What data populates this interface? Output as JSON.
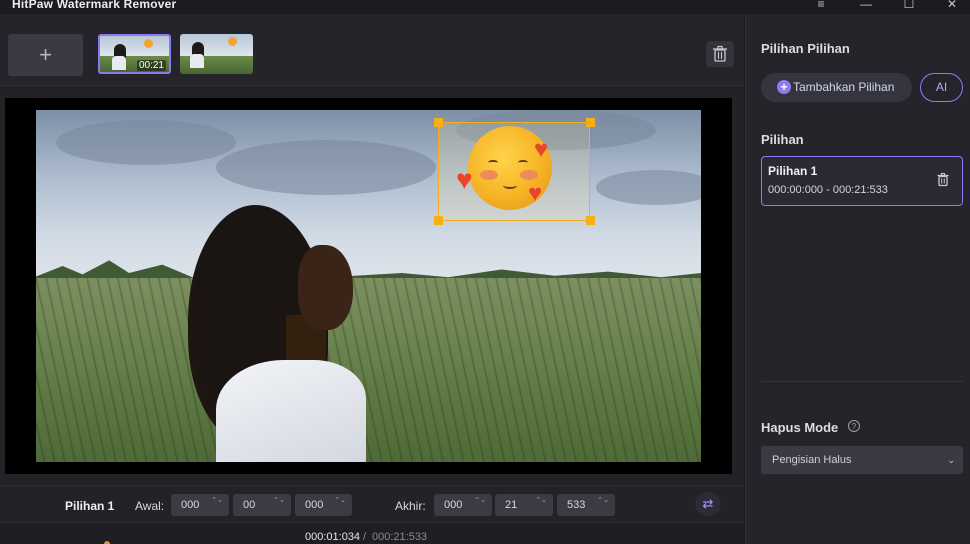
{
  "app": {
    "title": "HitPaw Watermark Remover",
    "window_controls": {
      "menu": "≡",
      "minimize": "—",
      "maximize": "☐",
      "close": "✕"
    }
  },
  "media_bar": {
    "add_label": "+",
    "thumbnails": [
      {
        "duration": "00:21",
        "selected": true
      },
      {
        "duration": "",
        "selected": false
      }
    ]
  },
  "controls": {
    "selection_label": "Pilihan 1",
    "start_label": "Awal:",
    "start": {
      "hours": "000",
      "minutes": "00",
      "ms": "000"
    },
    "end_label": "Akhir:",
    "end": {
      "hours": "000",
      "minutes": "21",
      "ms": "533"
    },
    "spin_arrows": "⌃⌄"
  },
  "timeline": {
    "current": "000:01:034",
    "separator": "/",
    "total": "000:21:533"
  },
  "sidebar": {
    "section_title": "Pilihan Pilihan",
    "add_selection_label": "Tambahkan Pilihan",
    "ai_label": "AI",
    "selections_title": "Pilihan",
    "selections": [
      {
        "name": "Pilihan 1",
        "range": "000:00:000 - 000:21:533"
      }
    ],
    "mode_title": "Hapus Mode",
    "mode_value": "Pengisian Halus",
    "help_symbol": "?"
  },
  "colors": {
    "accent": "#8f7bf3",
    "selection_box": "#f0b020"
  }
}
